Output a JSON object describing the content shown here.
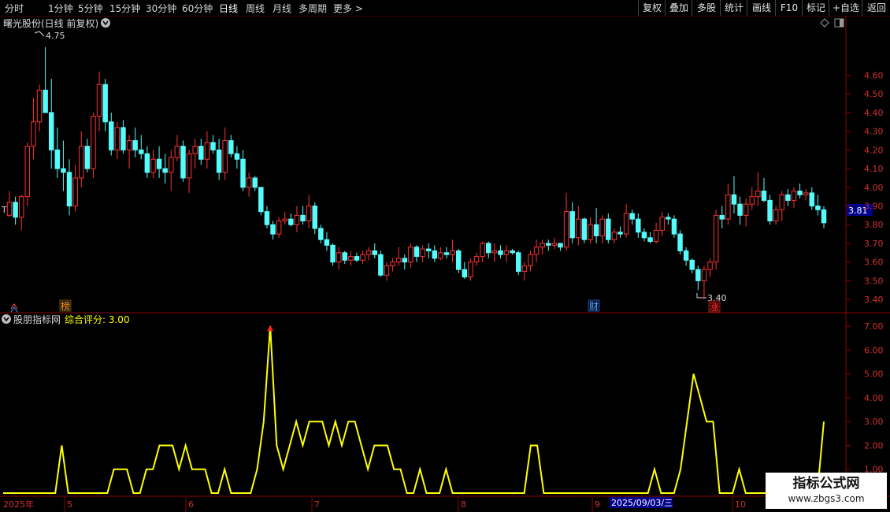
{
  "toolbar": {
    "left": [
      "分时",
      "1分钟",
      "5分钟",
      "15分钟",
      "30分钟",
      "60分钟",
      "日线",
      "周线",
      "月线",
      "多周期",
      "更多 >"
    ],
    "active": "日线",
    "right": [
      "复权",
      "叠加",
      "多股",
      "统计",
      "画线",
      "F10",
      "标记",
      "+自选",
      "返回"
    ]
  },
  "main_panel": {
    "title": "曙光股份(日线 前复权)",
    "last_price_label": "3.81",
    "high_marker": "4.75",
    "low_marker": "3.40",
    "left_marker": "T",
    "event_badges": [
      {
        "text": "榜",
        "color": "#ff8c00"
      },
      {
        "text": "财",
        "color": "#4aa0ff"
      },
      {
        "text": "涨",
        "color": "#ff3030"
      }
    ]
  },
  "indicator_panel": {
    "name": "股朋指标网",
    "series_label": "综合评分: 3.00"
  },
  "x_axis": {
    "labels": [
      "2025年",
      "5",
      "6",
      "7",
      "8",
      "9",
      "2025/09/03/三",
      "10"
    ]
  },
  "watermark": {
    "title": "指标公式网",
    "url": "www.zbgs3.com"
  },
  "chart_data": [
    {
      "type": "candlestick",
      "title": "曙光股份(日线 前复权)",
      "y_ticks": [
        "3.40",
        "3.50",
        "3.60",
        "3.70",
        "3.80",
        "3.90",
        "4.00",
        "4.10",
        "4.20",
        "4.30",
        "4.40",
        "4.50",
        "4.60"
      ],
      "ylim": [
        3.35,
        4.8
      ],
      "colors": {
        "up": "#ff3232",
        "down": "#54fcfc"
      },
      "ohlc": [
        [
          3.85,
          3.98,
          3.84,
          3.92
        ],
        [
          3.92,
          3.95,
          3.8,
          3.84
        ],
        [
          3.84,
          3.96,
          3.77,
          3.95
        ],
        [
          3.95,
          4.24,
          3.9,
          4.22
        ],
        [
          4.22,
          4.48,
          4.15,
          4.35
        ],
        [
          4.35,
          4.55,
          4.3,
          4.52
        ],
        [
          4.52,
          4.75,
          4.45,
          4.4
        ],
        [
          4.4,
          4.58,
          4.1,
          4.2
        ],
        [
          4.2,
          4.32,
          4.05,
          4.1
        ],
        [
          4.1,
          4.25,
          3.98,
          4.08
        ],
        [
          4.08,
          4.15,
          3.85,
          3.9
        ],
        [
          3.9,
          4.12,
          3.87,
          4.05
        ],
        [
          4.05,
          4.3,
          4.0,
          4.22
        ],
        [
          4.22,
          4.26,
          4.08,
          4.1
        ],
        [
          4.1,
          4.4,
          4.05,
          4.38
        ],
        [
          4.38,
          4.62,
          4.3,
          4.55
        ],
        [
          4.55,
          4.58,
          4.3,
          4.35
        ],
        [
          4.35,
          4.4,
          4.17,
          4.2
        ],
        [
          4.2,
          4.35,
          4.15,
          4.32
        ],
        [
          4.32,
          4.36,
          4.18,
          4.2
        ],
        [
          4.2,
          4.28,
          4.1,
          4.25
        ],
        [
          4.25,
          4.32,
          4.16,
          4.2
        ],
        [
          4.2,
          4.28,
          4.15,
          4.18
        ],
        [
          4.18,
          4.22,
          4.05,
          4.08
        ],
        [
          4.08,
          4.2,
          4.05,
          4.15
        ],
        [
          4.15,
          4.22,
          4.05,
          4.1
        ],
        [
          4.1,
          4.18,
          4.02,
          4.08
        ],
        [
          4.08,
          4.2,
          3.98,
          4.16
        ],
        [
          4.16,
          4.28,
          4.14,
          4.22
        ],
        [
          4.22,
          4.25,
          4.03,
          4.05
        ],
        [
          4.05,
          4.2,
          3.97,
          4.18
        ],
        [
          4.18,
          4.26,
          4.1,
          4.22
        ],
        [
          4.22,
          4.26,
          4.12,
          4.15
        ],
        [
          4.15,
          4.3,
          4.1,
          4.24
        ],
        [
          4.24,
          4.28,
          4.18,
          4.2
        ],
        [
          4.2,
          4.26,
          4.04,
          4.08
        ],
        [
          4.08,
          4.32,
          4.04,
          4.25
        ],
        [
          4.25,
          4.28,
          4.16,
          4.18
        ],
        [
          4.18,
          4.22,
          4.1,
          4.15
        ],
        [
          4.15,
          4.2,
          3.98,
          4.0
        ],
        [
          4.0,
          4.08,
          3.95,
          4.05
        ],
        [
          4.05,
          4.06,
          3.98,
          4.0
        ],
        [
          4.0,
          4.0,
          3.85,
          3.87
        ],
        [
          3.87,
          3.9,
          3.78,
          3.8
        ],
        [
          3.8,
          3.82,
          3.72,
          3.75
        ],
        [
          3.75,
          3.84,
          3.73,
          3.82
        ],
        [
          3.82,
          3.87,
          3.8,
          3.83
        ],
        [
          3.83,
          3.86,
          3.79,
          3.8
        ],
        [
          3.8,
          3.9,
          3.76,
          3.85
        ],
        [
          3.85,
          3.9,
          3.8,
          3.82
        ],
        [
          3.82,
          3.96,
          3.78,
          3.9
        ],
        [
          3.9,
          3.92,
          3.75,
          3.78
        ],
        [
          3.78,
          3.8,
          3.7,
          3.72
        ],
        [
          3.72,
          3.76,
          3.66,
          3.69
        ],
        [
          3.69,
          3.7,
          3.58,
          3.6
        ],
        [
          3.6,
          3.68,
          3.56,
          3.65
        ],
        [
          3.65,
          3.66,
          3.59,
          3.61
        ],
        [
          3.61,
          3.66,
          3.58,
          3.63
        ],
        [
          3.63,
          3.65,
          3.6,
          3.61
        ],
        [
          3.61,
          3.66,
          3.59,
          3.64
        ],
        [
          3.64,
          3.68,
          3.61,
          3.66
        ],
        [
          3.66,
          3.7,
          3.62,
          3.64
        ],
        [
          3.64,
          3.66,
          3.52,
          3.53
        ],
        [
          3.53,
          3.6,
          3.5,
          3.58
        ],
        [
          3.58,
          3.62,
          3.55,
          3.6
        ],
        [
          3.6,
          3.68,
          3.58,
          3.62
        ],
        [
          3.62,
          3.64,
          3.56,
          3.6
        ],
        [
          3.6,
          3.7,
          3.57,
          3.68
        ],
        [
          3.68,
          3.69,
          3.6,
          3.63
        ],
        [
          3.63,
          3.69,
          3.6,
          3.67
        ],
        [
          3.67,
          3.7,
          3.62,
          3.66
        ],
        [
          3.66,
          3.69,
          3.6,
          3.62
        ],
        [
          3.62,
          3.68,
          3.61,
          3.65
        ],
        [
          3.65,
          3.68,
          3.62,
          3.64
        ],
        [
          3.64,
          3.72,
          3.6,
          3.66
        ],
        [
          3.66,
          3.67,
          3.54,
          3.56
        ],
        [
          3.56,
          3.6,
          3.51,
          3.52
        ],
        [
          3.52,
          3.62,
          3.5,
          3.6
        ],
        [
          3.6,
          3.65,
          3.58,
          3.63
        ],
        [
          3.63,
          3.71,
          3.6,
          3.7
        ],
        [
          3.7,
          3.71,
          3.62,
          3.65
        ],
        [
          3.65,
          3.7,
          3.6,
          3.66
        ],
        [
          3.66,
          3.69,
          3.62,
          3.64
        ],
        [
          3.64,
          3.69,
          3.6,
          3.66
        ],
        [
          3.66,
          3.67,
          3.64,
          3.65
        ],
        [
          3.65,
          3.66,
          3.53,
          3.55
        ],
        [
          3.55,
          3.6,
          3.5,
          3.58
        ],
        [
          3.58,
          3.66,
          3.55,
          3.64
        ],
        [
          3.64,
          3.72,
          3.6,
          3.68
        ],
        [
          3.68,
          3.72,
          3.64,
          3.7
        ],
        [
          3.7,
          3.72,
          3.66,
          3.69
        ],
        [
          3.69,
          3.73,
          3.67,
          3.7
        ],
        [
          3.7,
          3.7,
          3.66,
          3.68
        ],
        [
          3.68,
          3.97,
          3.66,
          3.87
        ],
        [
          3.87,
          3.92,
          3.7,
          3.73
        ],
        [
          3.73,
          3.9,
          3.69,
          3.83
        ],
        [
          3.83,
          3.84,
          3.7,
          3.72
        ],
        [
          3.72,
          3.84,
          3.7,
          3.8
        ],
        [
          3.8,
          3.89,
          3.7,
          3.74
        ],
        [
          3.74,
          3.85,
          3.7,
          3.83
        ],
        [
          3.83,
          3.86,
          3.7,
          3.72
        ],
        [
          3.72,
          3.78,
          3.7,
          3.76
        ],
        [
          3.76,
          3.79,
          3.73,
          3.75
        ],
        [
          3.75,
          3.91,
          3.73,
          3.86
        ],
        [
          3.86,
          3.88,
          3.8,
          3.83
        ],
        [
          3.83,
          3.86,
          3.73,
          3.76
        ],
        [
          3.76,
          3.78,
          3.71,
          3.73
        ],
        [
          3.73,
          3.76,
          3.7,
          3.71
        ],
        [
          3.71,
          3.81,
          3.7,
          3.77
        ],
        [
          3.77,
          3.87,
          3.74,
          3.84
        ],
        [
          3.84,
          3.86,
          3.8,
          3.83
        ],
        [
          3.83,
          3.85,
          3.73,
          3.75
        ],
        [
          3.75,
          3.77,
          3.64,
          3.66
        ],
        [
          3.66,
          3.68,
          3.58,
          3.61
        ],
        [
          3.61,
          3.62,
          3.54,
          3.56
        ],
        [
          3.56,
          3.58,
          3.45,
          3.5
        ],
        [
          3.5,
          3.58,
          3.4,
          3.56
        ],
        [
          3.56,
          3.62,
          3.52,
          3.6
        ],
        [
          3.6,
          3.88,
          3.56,
          3.85
        ],
        [
          3.85,
          3.9,
          3.78,
          3.83
        ],
        [
          3.83,
          4.02,
          3.8,
          3.96
        ],
        [
          3.96,
          4.06,
          3.86,
          3.91
        ],
        [
          3.91,
          3.95,
          3.8,
          3.85
        ],
        [
          3.85,
          3.94,
          3.79,
          3.91
        ],
        [
          3.91,
          4.0,
          3.88,
          3.95
        ],
        [
          3.95,
          4.08,
          3.9,
          3.98
        ],
        [
          3.98,
          4.05,
          3.92,
          3.93
        ],
        [
          3.93,
          3.96,
          3.8,
          3.82
        ],
        [
          3.82,
          3.9,
          3.8,
          3.88
        ],
        [
          3.88,
          3.98,
          3.82,
          3.96
        ],
        [
          3.96,
          3.99,
          3.9,
          3.93
        ],
        [
          3.93,
          4.0,
          3.89,
          3.98
        ],
        [
          3.98,
          4.02,
          3.94,
          3.96
        ],
        [
          3.96,
          3.99,
          3.93,
          3.97
        ],
        [
          3.97,
          4.0,
          3.88,
          3.9
        ],
        [
          3.9,
          3.96,
          3.85,
          3.88
        ],
        [
          3.88,
          3.9,
          3.78,
          3.81
        ]
      ]
    },
    {
      "type": "line",
      "series": [
        {
          "name": "综合评分",
          "color": "#ffff00"
        }
      ],
      "y_ticks": [
        "1.00",
        "2.00",
        "3.00",
        "4.00",
        "5.00",
        "6.00",
        "7.00"
      ],
      "ylim": [
        0,
        7.4
      ],
      "values": [
        0,
        0,
        0,
        0,
        0,
        0,
        0,
        0,
        0,
        2,
        0,
        0,
        0,
        0,
        0,
        0,
        0,
        1,
        1,
        1,
        0,
        0,
        1,
        1,
        2,
        2,
        2,
        1,
        2,
        1,
        1,
        1,
        0,
        0,
        1,
        0,
        0,
        0,
        0,
        1,
        3,
        7,
        2,
        1,
        2,
        3,
        2,
        3,
        3,
        3,
        2,
        3,
        2,
        3,
        3,
        2,
        1,
        2,
        2,
        2,
        1,
        1,
        0,
        0,
        1,
        0,
        0,
        0,
        1,
        0,
        0,
        0,
        0,
        0,
        0,
        0,
        0,
        0,
        0,
        0,
        0,
        2,
        2,
        0,
        0,
        0,
        0,
        0,
        0,
        0,
        0,
        0,
        0,
        0,
        0,
        0,
        0,
        0,
        0,
        0,
        1,
        0,
        0,
        0,
        1,
        3,
        5,
        4,
        3,
        3,
        0,
        0,
        0,
        1,
        0,
        0,
        0,
        0,
        0,
        0,
        0,
        0,
        0,
        0,
        0,
        0,
        3
      ]
    }
  ]
}
